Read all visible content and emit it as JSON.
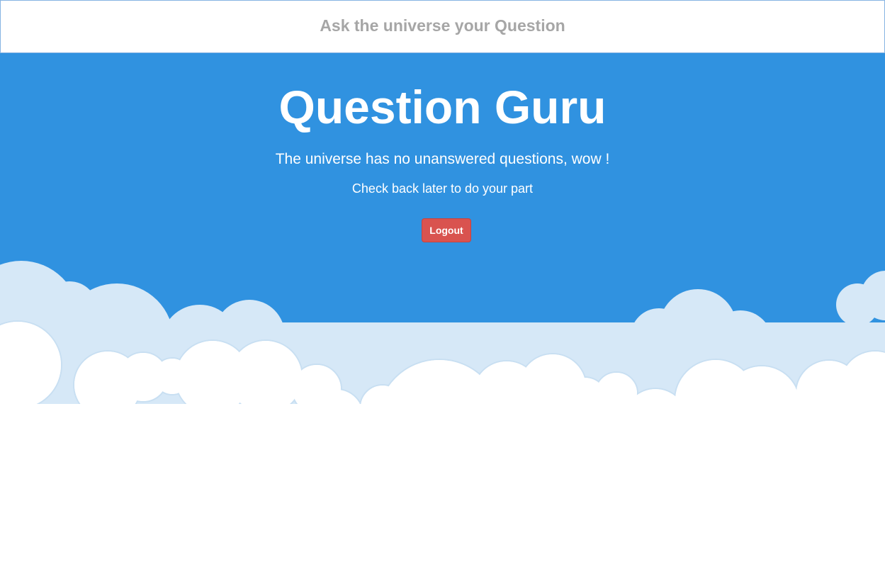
{
  "question_bar": {
    "placeholder": "Ask the universe your Question",
    "value": ""
  },
  "hero": {
    "title": "Question Guru",
    "subtitle": "The universe has no unanswered questions, wow !",
    "note": "Check back later to do your part",
    "logout_label": "Logout"
  },
  "colors": {
    "sky": "#3092e0",
    "logout_button": "#d9534f",
    "placeholder_text": "#a6a6a6",
    "back_cloud": "#d6e8f7",
    "front_cloud": "#ffffff"
  }
}
